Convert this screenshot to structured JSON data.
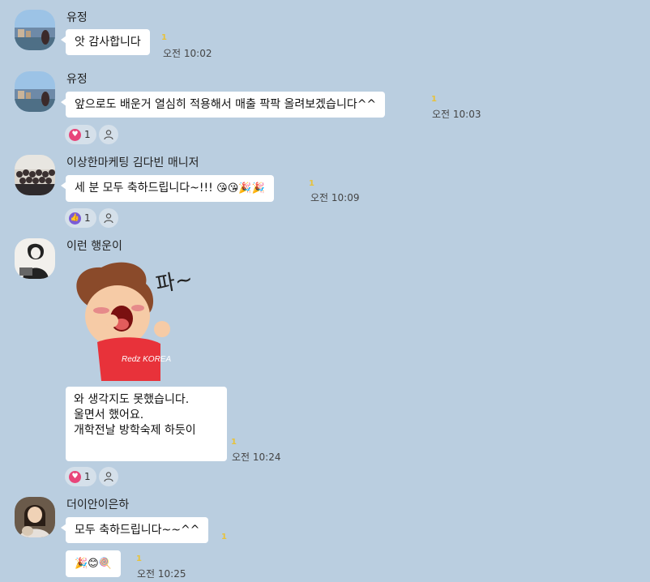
{
  "messages": [
    {
      "sender": "유정",
      "text": "앗 감사합니다",
      "unread": "1",
      "time": "오전 10:02"
    },
    {
      "sender": "유정",
      "text": "앞으로도 배운거 열심히 적용해서 매출 팍팍 올려보겠습니다^^",
      "unread": "1",
      "time": "오전 10:03",
      "reaction_count": "1"
    },
    {
      "sender": "이상한마케팅 김다빈 매니저",
      "text": "세 분 모두 축하드립니다~!!!",
      "emojis": "😘😘🎉🎉",
      "unread": "1",
      "time": "오전 10:09",
      "reaction_count": "1"
    },
    {
      "sender": "이런 행운이",
      "sticker_text": "파~",
      "shirt_text": "Redz KOREA",
      "text": "와 생각지도 못했습니다.\n울면서 했어요.\n개학전날 방학숙제 하듯이",
      "unread": "1",
      "time": "오전 10:24",
      "reaction_count": "1"
    },
    {
      "sender": "더이안이은하",
      "text": "모두 축하드립니다~~^^",
      "unread": "1",
      "emojis": "🎉😊🍭",
      "unread2": "1",
      "time": "오전 10:25"
    }
  ],
  "colors": {
    "background": "#bacee0",
    "bubble": "#ffffff",
    "unread": "#e8c23a",
    "heart": "#e8457a",
    "like": "#7b5cd6"
  }
}
